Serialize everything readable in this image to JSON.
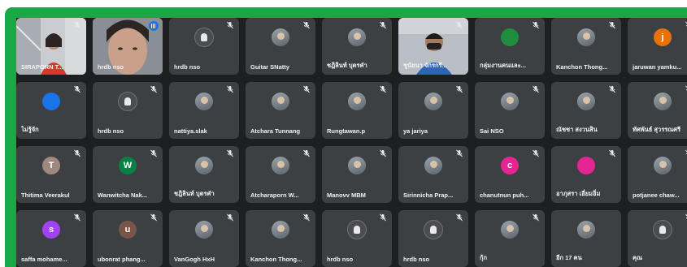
{
  "participants": [
    {
      "name": "SIRAPORN T...",
      "type": "camera",
      "scene": "office-woman",
      "muted": true
    },
    {
      "name": "hrdb nso",
      "type": "camera",
      "scene": "close-face",
      "speaking": true
    },
    {
      "name": "hrdb nso",
      "type": "generic",
      "muted": true
    },
    {
      "name": "Guitar SNatty",
      "type": "photo",
      "muted": true
    },
    {
      "name": "ชฎิลินท์ บุตรคำ",
      "type": "photo",
      "muted": true
    },
    {
      "name": "ชูนัยนา จักรกรี...",
      "type": "camera",
      "scene": "masked-man",
      "muted": true
    },
    {
      "name": "กลุ่มงานคนและ...",
      "type": "initial",
      "initial": "",
      "color": "#1e8e3e",
      "muted": true
    },
    {
      "name": "Kanchon Thong...",
      "type": "photo",
      "muted": true
    },
    {
      "name": "jaruwan yamku...",
      "type": "initial",
      "initial": "j",
      "color": "#e8710a",
      "muted": true
    },
    {
      "name": "ไม่รู้จัก",
      "type": "initial",
      "initial": "",
      "color": "#1a73e8",
      "muted": true
    },
    {
      "name": "hrdb nso",
      "type": "generic",
      "muted": true
    },
    {
      "name": "nattiya.slak",
      "type": "photo",
      "muted": true
    },
    {
      "name": "Atchara Tunnang",
      "type": "photo",
      "muted": true
    },
    {
      "name": "Rungtawan.p",
      "type": "photo",
      "muted": true
    },
    {
      "name": "ya jariya",
      "type": "photo",
      "muted": true
    },
    {
      "name": "Sai NSO",
      "type": "photo",
      "muted": true
    },
    {
      "name": "ณัชชา สงวนสิน",
      "type": "photo",
      "muted": true
    },
    {
      "name": "ทัศพันธ์ สุวรรณศรี",
      "type": "photo",
      "muted": true
    },
    {
      "name": "Thitima Veerakul",
      "type": "initial",
      "initial": "T",
      "color": "#a1887f",
      "muted": true
    },
    {
      "name": "Wanwitcha Nak...",
      "type": "initial",
      "initial": "W",
      "color": "#0b8043",
      "muted": true
    },
    {
      "name": "ชฎิลินท์ บุตรคำ",
      "type": "photo",
      "muted": true
    },
    {
      "name": "Atcharaporn W...",
      "type": "photo",
      "muted": true
    },
    {
      "name": "Manovv MBM",
      "type": "photo",
      "muted": true
    },
    {
      "name": "Sirinnicha Prap...",
      "type": "photo",
      "muted": true
    },
    {
      "name": "chanutnun puh...",
      "type": "initial",
      "initial": "c",
      "color": "#e52592",
      "muted": true
    },
    {
      "name": "อาภุสรา เอี่ยมอิ่ม",
      "type": "initial",
      "initial": "",
      "color": "#e52592",
      "muted": true
    },
    {
      "name": "potjanee chaw...",
      "type": "photo",
      "muted": true
    },
    {
      "name": "saffa mohame...",
      "type": "initial",
      "initial": "s",
      "color": "#a142f4",
      "muted": true
    },
    {
      "name": "ubonrat phang...",
      "type": "initial",
      "initial": "u",
      "color": "#795548",
      "muted": true
    },
    {
      "name": "VanGogh HxH",
      "type": "photo",
      "muted": true
    },
    {
      "name": "Kanchon Thong...",
      "type": "photo",
      "muted": true
    },
    {
      "name": "hrdb nso",
      "type": "generic",
      "muted": true
    },
    {
      "name": "hrdb nso",
      "type": "generic",
      "muted": true
    },
    {
      "name": "กุ้ก",
      "type": "photo",
      "muted": true
    },
    {
      "name": "อีก 17 คน",
      "type": "photo",
      "muted": false
    },
    {
      "name": "คุณ",
      "type": "generic",
      "muted": true
    }
  ]
}
